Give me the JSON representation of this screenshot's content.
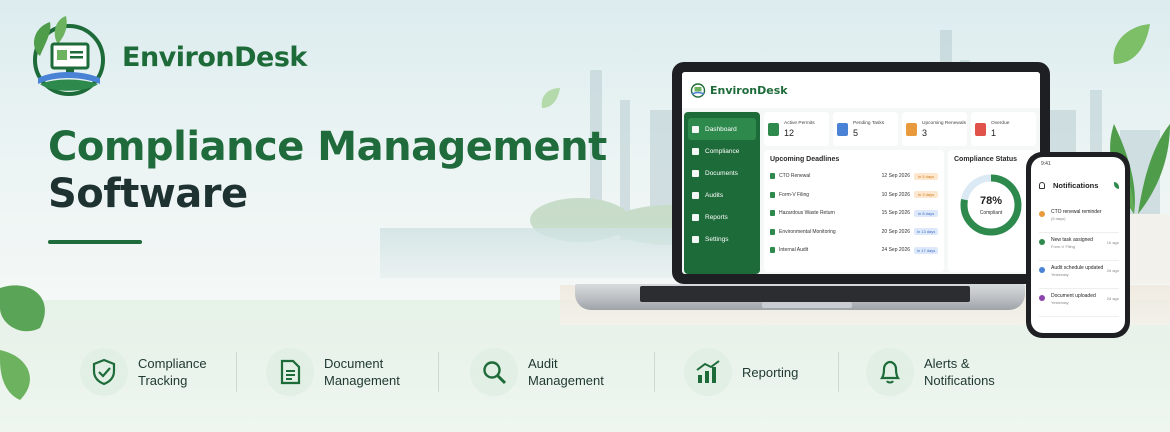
{
  "brand": {
    "name": "EnvironDesk"
  },
  "headline": {
    "line1": "Compliance Management",
    "line2": "Software"
  },
  "colors": {
    "primary": "#1e6b3a",
    "accent": "#2e8a4c",
    "dark": "#1e3232",
    "warning": "#e89a3c",
    "info": "#4a82d6",
    "danger": "#e0524a"
  },
  "laptop": {
    "app_title": "EnvironDesk",
    "sidebar": [
      {
        "label": "Dashboard",
        "icon": "home-icon",
        "active": true
      },
      {
        "label": "Compliance",
        "icon": "document-icon"
      },
      {
        "label": "Documents",
        "icon": "document-icon"
      },
      {
        "label": "Audits",
        "icon": "shield-icon"
      },
      {
        "label": "Reports",
        "icon": "bar-chart-icon"
      },
      {
        "label": "Settings",
        "icon": "gear-icon"
      }
    ],
    "stats": [
      {
        "label": "Active Permits",
        "value": "12",
        "icon_color": "#2e8a4c"
      },
      {
        "label": "Pending Tasks",
        "value": "5",
        "icon_color": "#4a82d6"
      },
      {
        "label": "Upcoming Renewals",
        "value": "3",
        "icon_color": "#e89a3c"
      },
      {
        "label": "Overdue",
        "value": "1",
        "icon_color": "#e0524a"
      }
    ],
    "deadlines": {
      "title": "Upcoming Deadlines",
      "rows": [
        {
          "name": "CTO Renewal",
          "date": "12 Sep 2026",
          "badge": "In 5 days",
          "tone": "orange"
        },
        {
          "name": "Form-V Filing",
          "date": "10 Sep 2026",
          "badge": "In 3 days",
          "tone": "orange"
        },
        {
          "name": "Hazardous Waste Return",
          "date": "15 Sep 2026",
          "badge": "In 8 days",
          "tone": "blue"
        },
        {
          "name": "Environmental Monitoring",
          "date": "20 Sep 2026",
          "badge": "In 13 days",
          "tone": "blue"
        },
        {
          "name": "Internal Audit",
          "date": "24 Sep 2026",
          "badge": "In 17 days",
          "tone": "blue"
        }
      ]
    },
    "status": {
      "title": "Compliance Status",
      "percent_text": "78%",
      "percent": 78,
      "caption": "Compliant"
    }
  },
  "phone": {
    "time": "9:41",
    "title": "Notifications",
    "items": [
      {
        "title": "CTO renewal reminder",
        "sub": "(5 days)",
        "time": "",
        "color": "#e89a3c"
      },
      {
        "title": "New task assigned",
        "sub": "Form-V Filing",
        "time": "1h ago",
        "color": "#2e8a4c"
      },
      {
        "title": "Audit schedule updated",
        "sub": "Yesterday",
        "time": "2d ago",
        "color": "#4a82d6"
      },
      {
        "title": "Document uploaded",
        "sub": "Yesterday",
        "time": "2d ago",
        "color": "#8e44ad"
      }
    ]
  },
  "features": [
    {
      "label_1": "Compliance",
      "label_2": "Tracking",
      "icon": "shield-check-icon"
    },
    {
      "label_1": "Document",
      "label_2": "Management",
      "icon": "document-icon"
    },
    {
      "label_1": "Audit",
      "label_2": "Management",
      "icon": "magnifier-icon"
    },
    {
      "label_1": "Reporting",
      "label_2": "",
      "icon": "growth-chart-icon"
    },
    {
      "label_1": "Alerts &",
      "label_2": "Notifications",
      "icon": "bell-icon"
    }
  ]
}
